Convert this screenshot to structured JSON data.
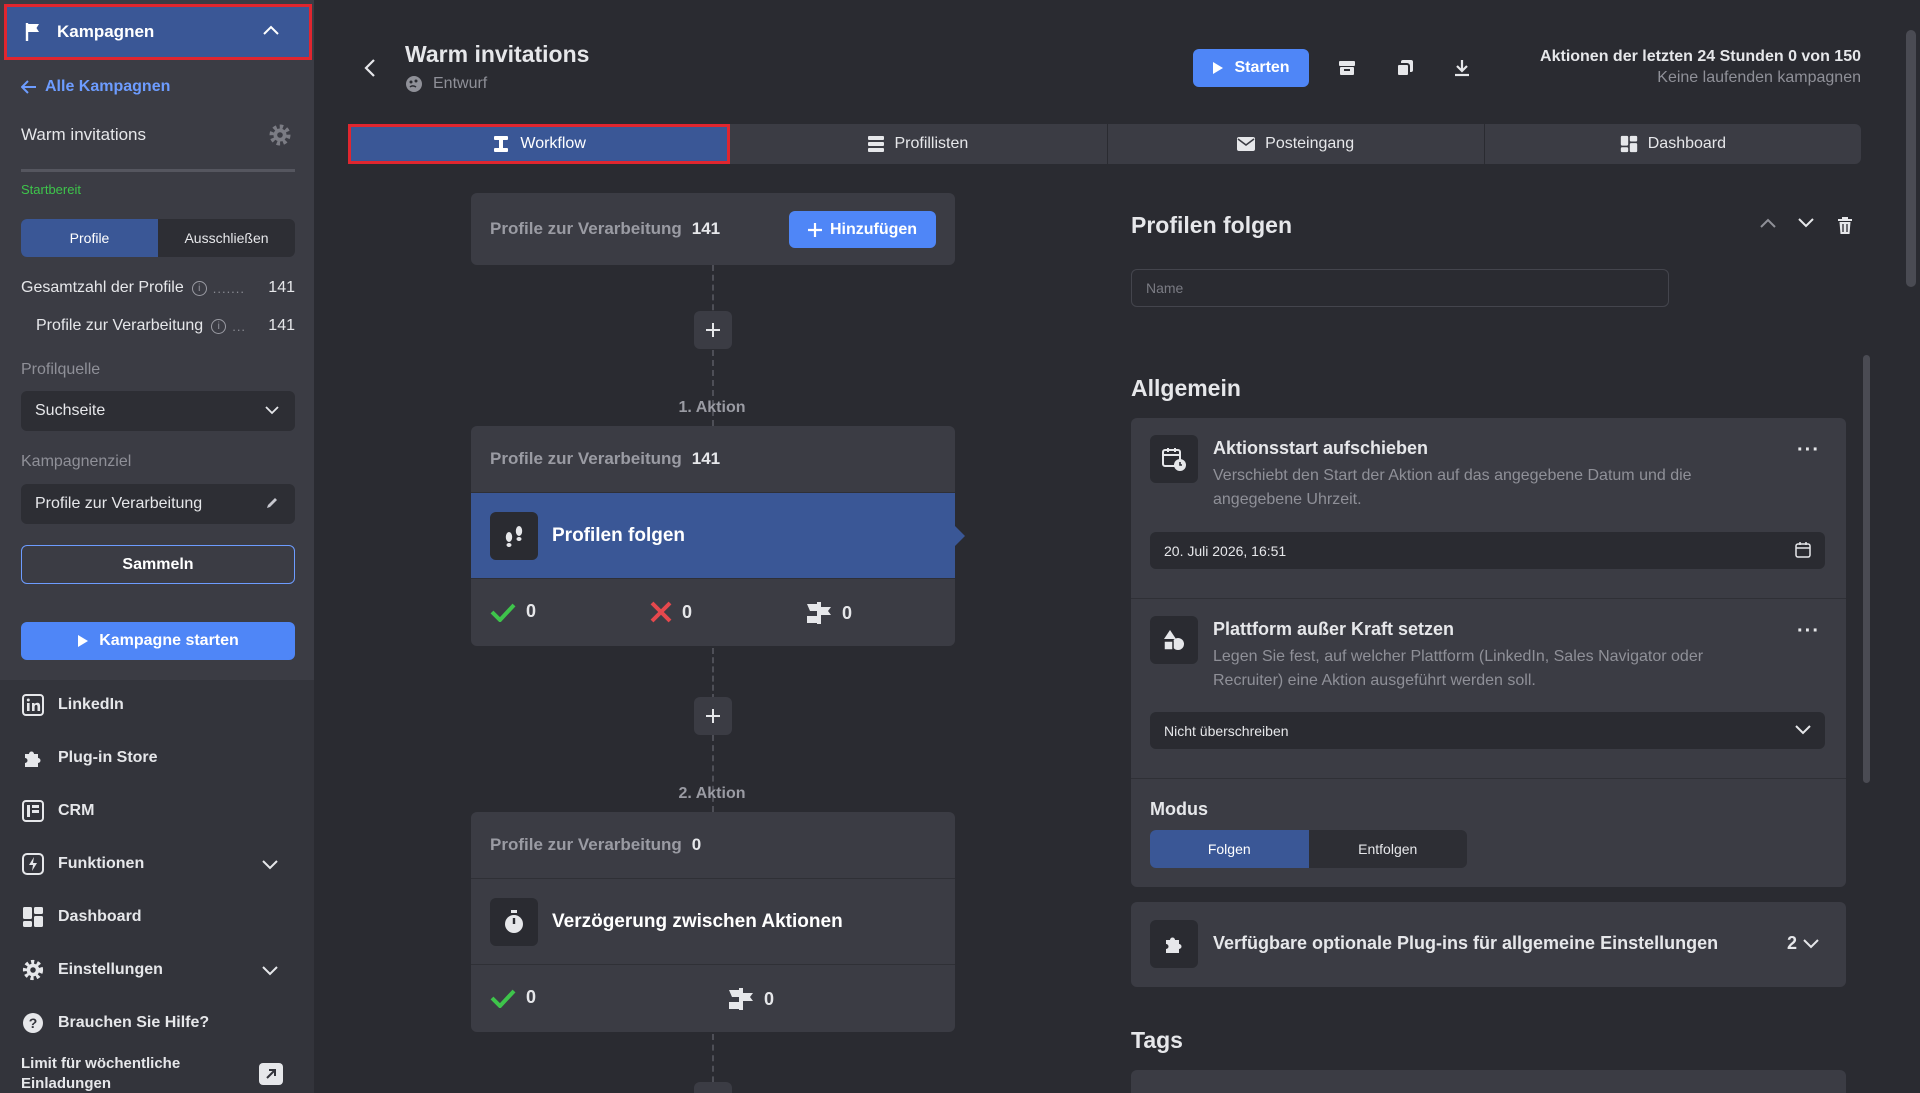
{
  "sidebar": {
    "campaigns_label": "Kampagnen",
    "back_label": "Alle Kampagnen",
    "campaign_name": "Warm invitations",
    "status": "Startbereit",
    "segment": [
      "Profile",
      "Ausschließen"
    ],
    "total_profiles_label": "Gesamtzahl der Profile",
    "total_profiles_dots": ".......",
    "total_profiles_value": "141",
    "processing_label": "Profile zur Verarbeitung",
    "processing_dots": "...",
    "processing_value": "141",
    "source_label": "Profilquelle",
    "source_value": "Suchseite",
    "goal_label": "Kampagnenziel",
    "goal_value": "Profile zur Verarbeitung",
    "collect_label": "Sammeln",
    "start_campaign_label": "Kampagne starten",
    "nav": [
      "LinkedIn",
      "Plug-in Store",
      "CRM",
      "Funktionen",
      "Dashboard",
      "Einstellungen",
      "Brauchen Sie Hilfe?"
    ],
    "limit_label": "Limit für wöchentliche Einladungen"
  },
  "header": {
    "title": "Warm invitations",
    "status": "Entwurf",
    "start_label": "Starten",
    "actions_line1": "Aktionen der letzten 24 Stunden 0 von 150",
    "actions_line2": "Keine laufenden kampagnen"
  },
  "tabs": [
    "Workflow",
    "Profillisten",
    "Posteingang",
    "Dashboard"
  ],
  "workflow": {
    "top_card": {
      "label": "Profile zur Verarbeitung",
      "count": "141",
      "add_label": "Hinzufügen"
    },
    "action1": {
      "step": "1. Aktion",
      "label": "Profile zur Verarbeitung",
      "count": "141",
      "name": "Profilen folgen",
      "success": "0",
      "failed": "0",
      "skipped": "0"
    },
    "action2": {
      "step": "2. Aktion",
      "label": "Profile zur Verarbeitung",
      "count": "0",
      "name": "Verzögerung zwischen Aktionen",
      "success": "0",
      "skipped": "0"
    }
  },
  "panel": {
    "title": "Profilen folgen",
    "name_placeholder": "Name",
    "general_title": "Allgemein",
    "delay_title": "Aktionsstart aufschieben",
    "delay_desc": "Verschiebt den Start der Aktion auf das angegebene Datum und die angegebene Uhrzeit.",
    "delay_value": "20. Juli 2026, 16:51",
    "platform_title": "Plattform außer Kraft setzen",
    "platform_desc": "Legen Sie fest, auf welcher Plattform (LinkedIn, Sales Navigator oder Recruiter) eine Aktion ausgeführt werden soll.",
    "platform_value": "Nicht überschreiben",
    "mode_label": "Modus",
    "mode_options": [
      "Folgen",
      "Entfolgen"
    ],
    "plugins_label": "Verfügbare optionale Plug-ins für allgemeine Einstellungen",
    "plugins_count": "2",
    "tags_title": "Tags",
    "more_glyph": "···"
  },
  "colors": {
    "accent": "#4f86f7",
    "selected": "#3a5796",
    "highlight_border": "#e0262f",
    "success": "#3ec44b",
    "error": "#e5484d"
  }
}
